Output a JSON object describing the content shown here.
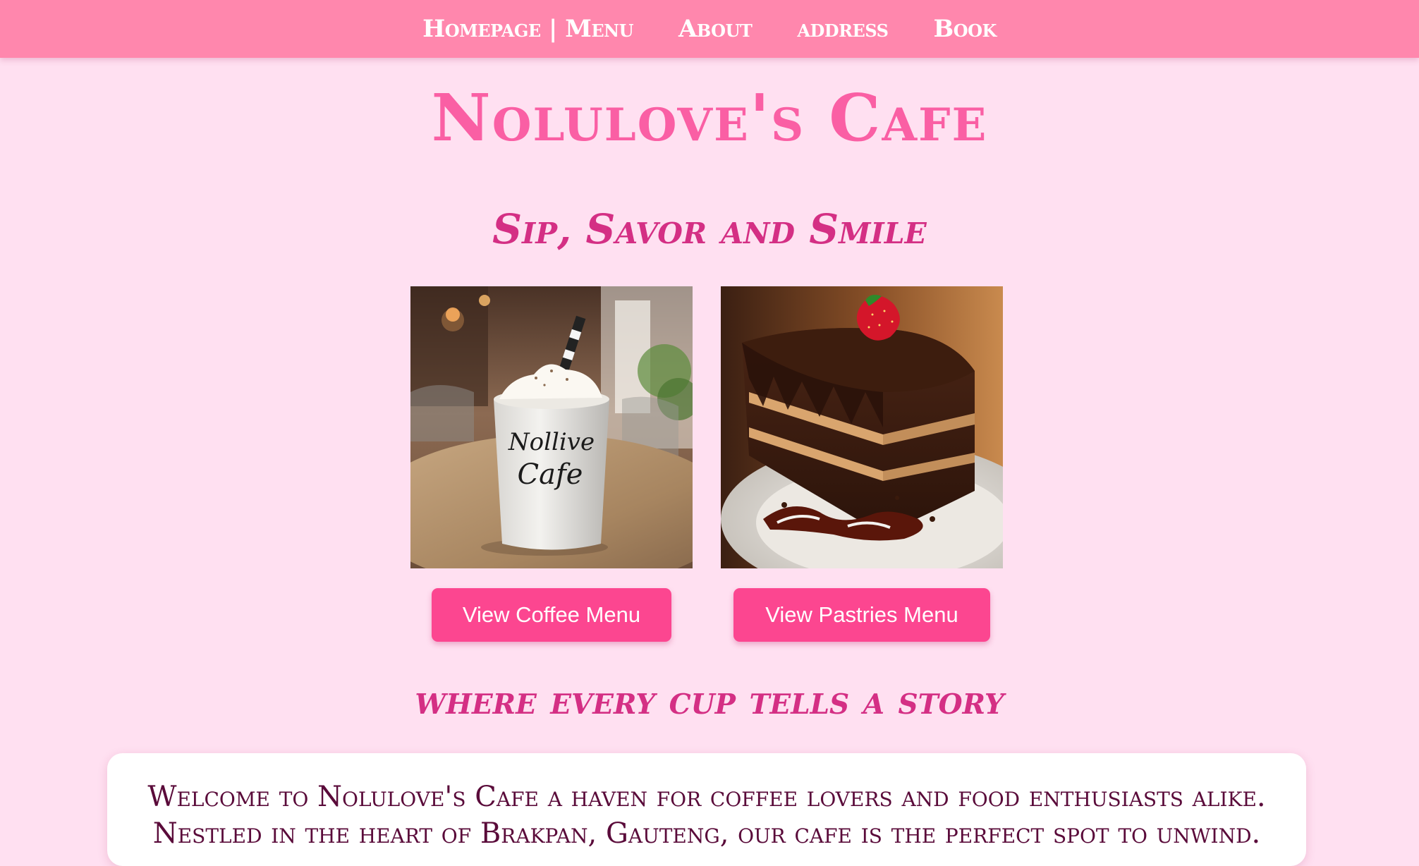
{
  "nav": {
    "items": [
      {
        "label": "Homepage | Menu"
      },
      {
        "label": "About"
      },
      {
        "label": "address"
      },
      {
        "label": "Book"
      }
    ]
  },
  "header": {
    "title": "Nolulove's Cafe"
  },
  "hero": {
    "tagline": "Sip, Savor and Smile",
    "coffee_image": {
      "icon": "coffee-cup-image",
      "cup_text_line1": "Nollive",
      "cup_text_line2": "Cafe"
    },
    "pastry_image": {
      "icon": "chocolate-cake-image"
    },
    "coffee_button": "View Coffee Menu",
    "pastries_button": "View Pastries Menu"
  },
  "story": {
    "heading": "where every cup tells a story",
    "welcome": "Welcome to Nolulove's Cafe a haven for coffee lovers and food enthusiasts alike. Nestled in the heart of Brakpan, Gauteng, our cafe is the perfect spot to unwind."
  },
  "colors": {
    "background": "#ffe0f1",
    "navbar": "#ff87ad",
    "title": "#fa5fa4",
    "accent": "#d42f84",
    "button": "#fc4690",
    "text": "#5a0b3a"
  }
}
